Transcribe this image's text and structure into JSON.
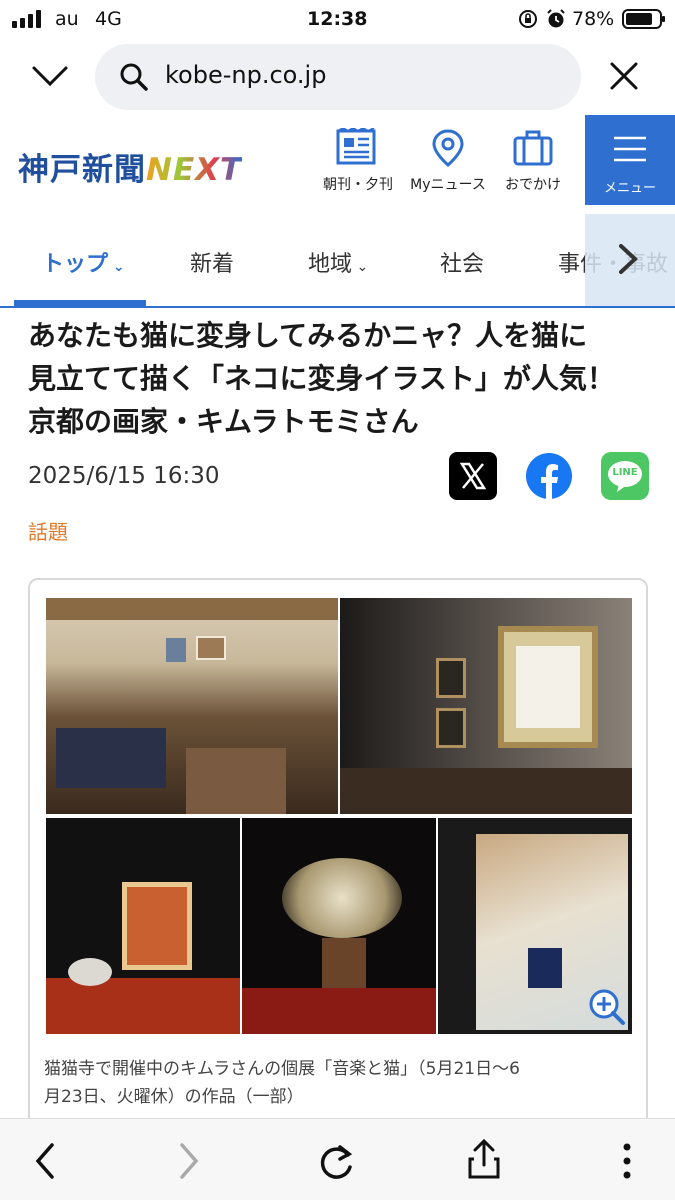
{
  "status_bar": {
    "carrier": "au",
    "network": "4G",
    "time": "12:38",
    "battery": "78%"
  },
  "browser": {
    "url": "kobe-np.co.jp"
  },
  "site": {
    "logo_jp": "神戸新聞",
    "logo_next": "NEXT",
    "header_links": [
      {
        "label": "朝刊・夕刊",
        "icon": "newspaper-icon"
      },
      {
        "label": "Myニュース",
        "icon": "map-pin-icon"
      },
      {
        "label": "おでかけ",
        "icon": "suitcase-icon"
      }
    ],
    "menu_label": "メニュー"
  },
  "nav": {
    "tabs": [
      {
        "label": "トップ",
        "dropdown": true,
        "active": true
      },
      {
        "label": "新着",
        "dropdown": false,
        "active": false
      },
      {
        "label": "地域",
        "dropdown": true,
        "active": false
      },
      {
        "label": "社会",
        "dropdown": false,
        "active": false
      },
      {
        "label": "事件・事故",
        "dropdown": false,
        "active": false
      }
    ]
  },
  "article": {
    "headline_lines": [
      "あなたも猫に変身してみるかニャ？人を猫に",
      "見立てて描く「ネコに変身イラスト」が人気！",
      "京都の画家・キムラトモミさん"
    ],
    "date": "2025/6/15 16:30",
    "category": "話題",
    "caption_lines": [
      "猫猫寺で開催中のキムラさんの個展「音楽と猫」（5月21日～6",
      "月23日、火曜休）の作品（一部）"
    ]
  },
  "share": {
    "line_label": "LINE"
  },
  "colors": {
    "brand_blue": "#2f6fd0",
    "logo_blue": "#1f4f9d",
    "category_orange": "#e07a2c",
    "facebook_blue": "#1877f2",
    "line_green": "#4cc764"
  }
}
